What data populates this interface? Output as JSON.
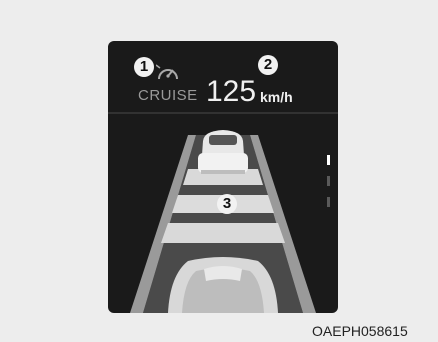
{
  "callouts": [
    "1",
    "2",
    "3"
  ],
  "cruise": {
    "label": "CRUISE",
    "icon": "cruise-control-speedometer-icon"
  },
  "speed": {
    "value": "125",
    "unit": "km/h"
  },
  "distance_level": {
    "bars": 3,
    "active_bars": 1
  },
  "figure_code": "OAEPH058615"
}
